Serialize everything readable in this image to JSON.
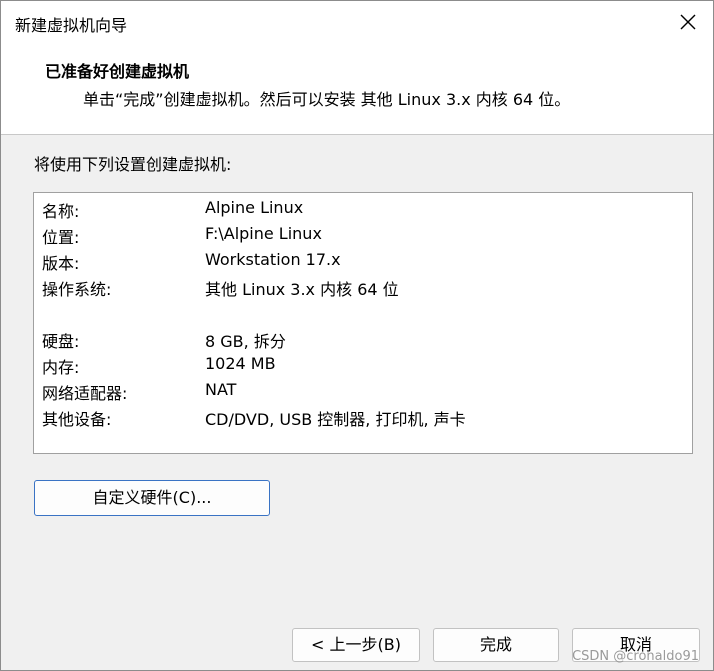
{
  "window": {
    "title": "新建虚拟机向导"
  },
  "header": {
    "title": "已准备好创建虚拟机",
    "subtitle": "单击“完成”创建虚拟机。然后可以安装 其他 Linux 3.x 内核 64 位。"
  },
  "body": {
    "intro": "将使用下列设置创建虚拟机:"
  },
  "summary": {
    "rows": [
      {
        "key": "名称:",
        "value": "Alpine Linux"
      },
      {
        "key": "位置:",
        "value": "F:\\Alpine Linux"
      },
      {
        "key": "版本:",
        "value": "Workstation 17.x"
      },
      {
        "key": "操作系统:",
        "value": "其他 Linux 3.x 内核 64 位"
      },
      {
        "key": "硬盘:",
        "value": "8 GB, 拆分"
      },
      {
        "key": "内存:",
        "value": "1024 MB"
      },
      {
        "key": "网络适配器:",
        "value": "NAT"
      },
      {
        "key": "其他设备:",
        "value": "CD/DVD, USB 控制器, 打印机, 声卡"
      }
    ]
  },
  "buttons": {
    "customize": "自定义硬件(C)...",
    "back": "< 上一步(B)",
    "finish": "完成",
    "cancel": "取消"
  },
  "watermark": "CSDN @cronaldo91",
  "icons": {
    "close": "close-icon"
  }
}
